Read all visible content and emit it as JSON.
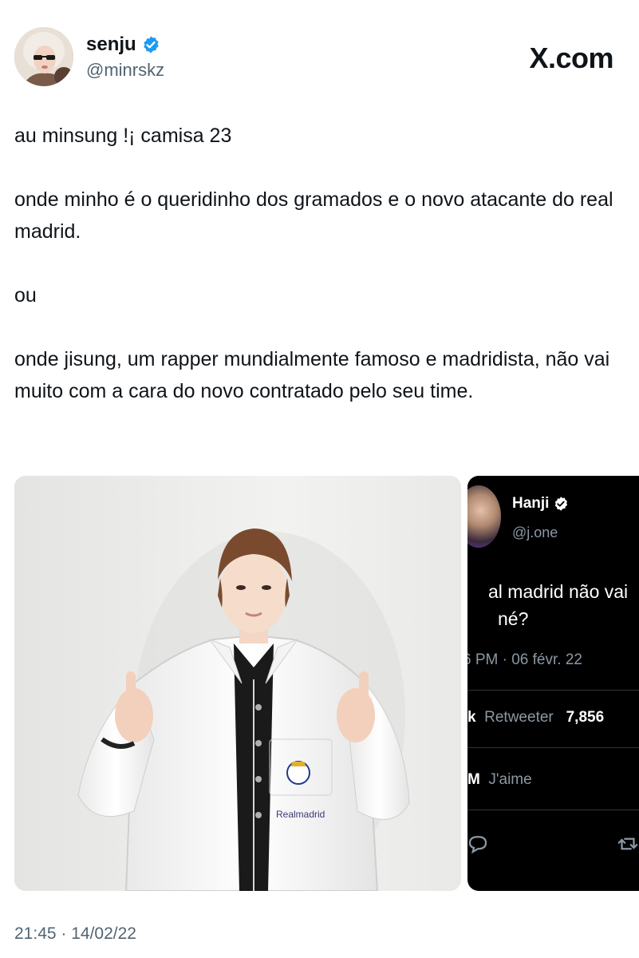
{
  "author": {
    "display_name": "senju",
    "handle": "@minrskz",
    "verified": true
  },
  "brand": "X.com",
  "tweet": {
    "paragraphs": [
      "au minsung !¡ camisa 23",
      "onde minho é o queridinho dos gramados e o novo atacante do real madrid.",
      "ou",
      "onde jisung, um rapper mundialmente famoso e madridista, não vai muito com a cara do novo contratado pelo seu time."
    ],
    "timestamp": "21:45 · 14/02/22"
  },
  "media": {
    "photo": {
      "shirt_text": "Realmadrid"
    },
    "embedded_screenshot": {
      "name": "Hanji",
      "handle": "@j.one",
      "text_line_1": "al madrid não vai",
      "text_line_2": "né?",
      "time": "6 PM · 06 févr. 22",
      "retweet_label": "Retweeter",
      "retweet_prefix": "k",
      "retweet_count": "7,856",
      "like_prefix": "M",
      "like_label": "J'aime"
    }
  },
  "colors": {
    "verified_blue": "#1d9bf0",
    "text": "#0f1419",
    "secondary": "#536471"
  }
}
